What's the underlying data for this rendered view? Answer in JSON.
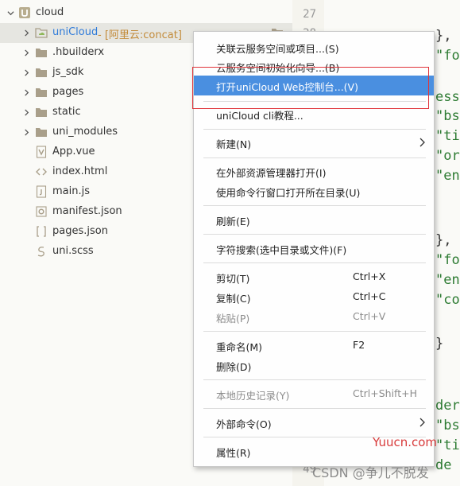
{
  "tree": {
    "root": {
      "label": "cloud"
    },
    "items": [
      {
        "label": "uniCloud",
        "tag": "- [阿里云:concat]",
        "type": "folder-cloud"
      },
      {
        "label": ".hbuilderx",
        "type": "folder"
      },
      {
        "label": "js_sdk",
        "type": "folder"
      },
      {
        "label": "pages",
        "type": "folder"
      },
      {
        "label": "static",
        "type": "folder"
      },
      {
        "label": "uni_modules",
        "type": "folder"
      },
      {
        "label": "App.vue",
        "type": "file-vue"
      },
      {
        "label": "index.html",
        "type": "file-html"
      },
      {
        "label": "main.js",
        "type": "file-js"
      },
      {
        "label": "manifest.json",
        "type": "file-json-gear"
      },
      {
        "label": "pages.json",
        "type": "file-json"
      },
      {
        "label": "uni.scss",
        "type": "file-scss"
      }
    ]
  },
  "editor": {
    "line_numbers": [
      "27",
      "28",
      "49"
    ],
    "code_lines": [
      "},",
      "\"fo",
      "ess",
      "\"bs",
      "\"ti",
      "\"or",
      "\"en",
      "},",
      "\"fo",
      "\"en",
      "\"co",
      "}",
      "der",
      "\"bs",
      "\"ti",
      "de"
    ]
  },
  "menu": {
    "items": [
      {
        "label": "关联云服务空间或项目...(S)",
        "shortcut": ""
      },
      {
        "label": "云服务空间初始化向导...(B)",
        "shortcut": ""
      },
      {
        "label": "打开uniCloud Web控制台...(V)",
        "shortcut": ""
      },
      {
        "label": "uniCloud cli教程...",
        "shortcut": ""
      },
      {
        "label": "新建(N)",
        "shortcut": ""
      },
      {
        "label": "在外部资源管理器打开(I)",
        "shortcut": ""
      },
      {
        "label": "使用命令行窗口打开所在目录(U)",
        "shortcut": ""
      },
      {
        "label": "刷新(E)",
        "shortcut": ""
      },
      {
        "label": "字符搜索(选中目录或文件)(F)",
        "shortcut": ""
      },
      {
        "label": "剪切(T)",
        "shortcut": "Ctrl+X"
      },
      {
        "label": "复制(C)",
        "shortcut": "Ctrl+C"
      },
      {
        "label": "粘贴(P)",
        "shortcut": "Ctrl+V"
      },
      {
        "label": "重命名(M)",
        "shortcut": "F2"
      },
      {
        "label": "删除(D)",
        "shortcut": ""
      },
      {
        "label": "本地历史记录(Y)",
        "shortcut": "Ctrl+Shift+H"
      },
      {
        "label": "外部命令(O)",
        "shortcut": ""
      },
      {
        "label": "属性(R)",
        "shortcut": ""
      }
    ]
  },
  "watermarks": {
    "site": "Yuucn.com",
    "csdn": "CSDN @争儿不脱发"
  },
  "colors": {
    "menu_highlight": "#4a8fe0",
    "annotation_box": "#e0343a",
    "folder_icon": "#a99f8a",
    "cloud_label": "#2f7bd9",
    "code_string": "#2d7b32"
  }
}
